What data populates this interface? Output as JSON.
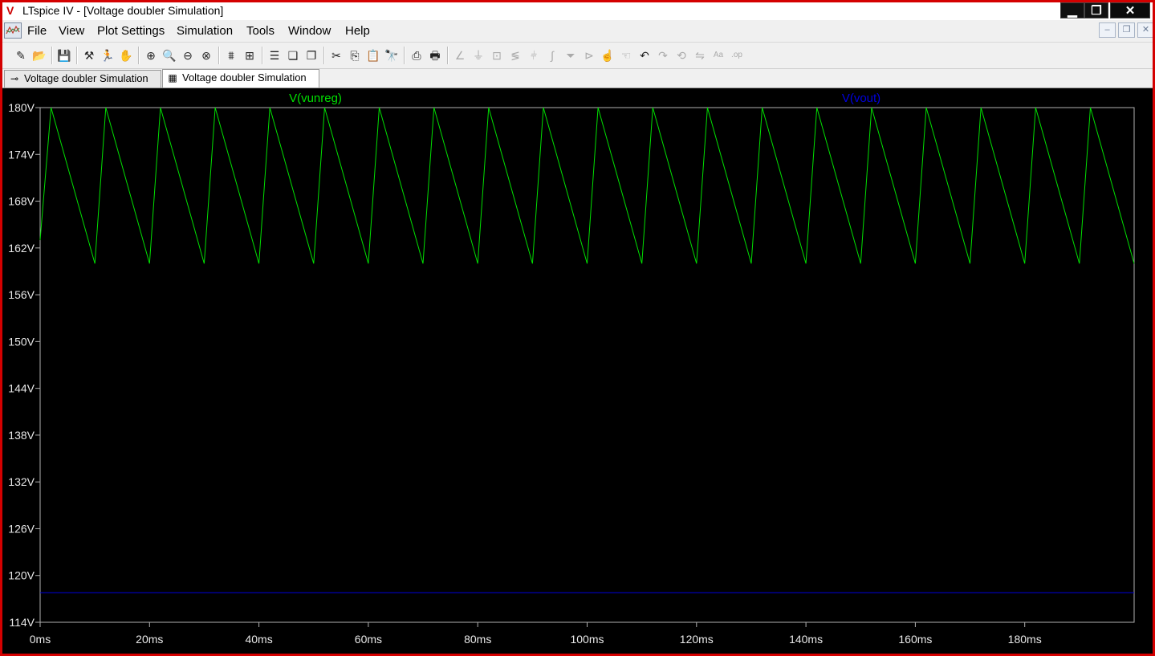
{
  "window": {
    "title": "LTspice IV - [Voltage doubler Simulation]",
    "app_icon_glyph": "V",
    "buttons": {
      "minimize": "▁",
      "restore": "❐",
      "close": "✕"
    }
  },
  "menubar": {
    "items": [
      "File",
      "View",
      "Plot Settings",
      "Simulation",
      "Tools",
      "Window",
      "Help"
    ],
    "mdi_buttons": {
      "minimize": "–",
      "restore": "❐",
      "close": "✕"
    }
  },
  "toolbar": {
    "icons": [
      {
        "name": "new-schematic-icon",
        "glyph": "✎",
        "enabled": true
      },
      {
        "name": "open-icon",
        "glyph": "📂",
        "enabled": true
      },
      {
        "name": "save-icon",
        "glyph": "💾",
        "enabled": true
      },
      {
        "name": "control-panel-icon",
        "glyph": "⚒",
        "enabled": true
      },
      {
        "name": "run-icon",
        "glyph": "🏃",
        "enabled": true
      },
      {
        "name": "pan-icon",
        "glyph": "✋",
        "enabled": true
      },
      {
        "name": "zoom-area-icon",
        "glyph": "⊕",
        "enabled": true
      },
      {
        "name": "zoom-in-icon",
        "glyph": "🔍",
        "enabled": true
      },
      {
        "name": "zoom-out-icon",
        "glyph": "⊖",
        "enabled": true
      },
      {
        "name": "zoom-fit-icon",
        "glyph": "⊗",
        "enabled": true
      },
      {
        "name": "autorange-icon",
        "glyph": "⩩",
        "enabled": true
      },
      {
        "name": "delete-trace-icon",
        "glyph": "⊞",
        "enabled": true
      },
      {
        "name": "tile-horizontal-icon",
        "glyph": "☰",
        "enabled": true
      },
      {
        "name": "cascade-icon",
        "glyph": "❏",
        "enabled": true
      },
      {
        "name": "tile-vertical-icon",
        "glyph": "❐",
        "enabled": true
      },
      {
        "name": "cut-icon",
        "glyph": "✂",
        "enabled": true
      },
      {
        "name": "copy-icon",
        "glyph": "⎘",
        "enabled": true
      },
      {
        "name": "paste-icon",
        "glyph": "📋",
        "enabled": true
      },
      {
        "name": "find-icon",
        "glyph": "🔭",
        "enabled": true
      },
      {
        "name": "print-preview-icon",
        "glyph": "⎙",
        "enabled": true
      },
      {
        "name": "print-icon",
        "glyph": "🖶",
        "enabled": true
      },
      {
        "name": "wire-icon",
        "glyph": "∠",
        "enabled": false
      },
      {
        "name": "ground-icon",
        "glyph": "⏚",
        "enabled": false
      },
      {
        "name": "label-icon",
        "glyph": "⊡",
        "enabled": false
      },
      {
        "name": "resistor-icon",
        "glyph": "≶",
        "enabled": false
      },
      {
        "name": "capacitor-icon",
        "glyph": "⫩",
        "enabled": false
      },
      {
        "name": "inductor-icon",
        "glyph": "∫",
        "enabled": false
      },
      {
        "name": "diode-icon",
        "glyph": "⏷",
        "enabled": false
      },
      {
        "name": "component-icon",
        "glyph": "⊳",
        "enabled": false
      },
      {
        "name": "move-icon",
        "glyph": "☝",
        "enabled": false
      },
      {
        "name": "drag-icon",
        "glyph": "☜",
        "enabled": false
      },
      {
        "name": "undo-icon",
        "glyph": "↶",
        "enabled": true
      },
      {
        "name": "redo-icon",
        "glyph": "↷",
        "enabled": false
      },
      {
        "name": "rotate-icon",
        "glyph": "⟲",
        "enabled": false
      },
      {
        "name": "mirror-icon",
        "glyph": "⇋",
        "enabled": false
      },
      {
        "name": "text-icon",
        "glyph": "Aa",
        "enabled": false
      },
      {
        "name": "spice-directive-icon",
        "glyph": ".op",
        "enabled": false
      }
    ]
  },
  "tabs": [
    {
      "label": "Voltage doubler Simulation",
      "icon": "schematic-icon",
      "glyph": "⊸",
      "active": false
    },
    {
      "label": "Voltage doubler Simulation",
      "icon": "waveform-icon",
      "glyph": "▦",
      "active": true
    }
  ],
  "chart_data": {
    "type": "line",
    "background": "#000000",
    "grid": false,
    "xlabel": "",
    "ylabel": "",
    "x_unit": "ms",
    "y_unit": "V",
    "xlim": [
      0,
      200
    ],
    "ylim": [
      114,
      180
    ],
    "x_ticks": [
      "0ms",
      "20ms",
      "40ms",
      "60ms",
      "80ms",
      "100ms",
      "120ms",
      "140ms",
      "160ms",
      "180ms"
    ],
    "y_ticks": [
      "180V",
      "174V",
      "168V",
      "162V",
      "156V",
      "150V",
      "144V",
      "138V",
      "132V",
      "126V",
      "120V",
      "114V"
    ],
    "series": [
      {
        "name": "V(vunreg)",
        "color": "#00e000",
        "shape": "sawtooth",
        "x": [
          0,
          2,
          10,
          12,
          20,
          22,
          30,
          32,
          40,
          42,
          50,
          52,
          60,
          62,
          70,
          72,
          80,
          82,
          90,
          92,
          100,
          102,
          110,
          112,
          120,
          122,
          130,
          132,
          140,
          142,
          150,
          152,
          160,
          162,
          170,
          172,
          180,
          182,
          190,
          192,
          200
        ],
        "y": [
          163,
          180,
          160,
          180,
          160,
          180,
          160,
          180,
          160,
          180,
          160,
          180,
          160,
          180,
          160,
          180,
          160,
          180,
          160,
          180,
          160,
          180,
          160,
          180,
          160,
          180,
          160,
          180,
          160,
          180,
          160,
          180,
          160,
          180,
          160,
          180,
          160,
          180,
          160,
          180,
          160
        ]
      },
      {
        "name": "V(vout)",
        "color": "#0000e0",
        "x": [
          0,
          200
        ],
        "y": [
          117.8,
          117.8
        ]
      }
    ]
  }
}
